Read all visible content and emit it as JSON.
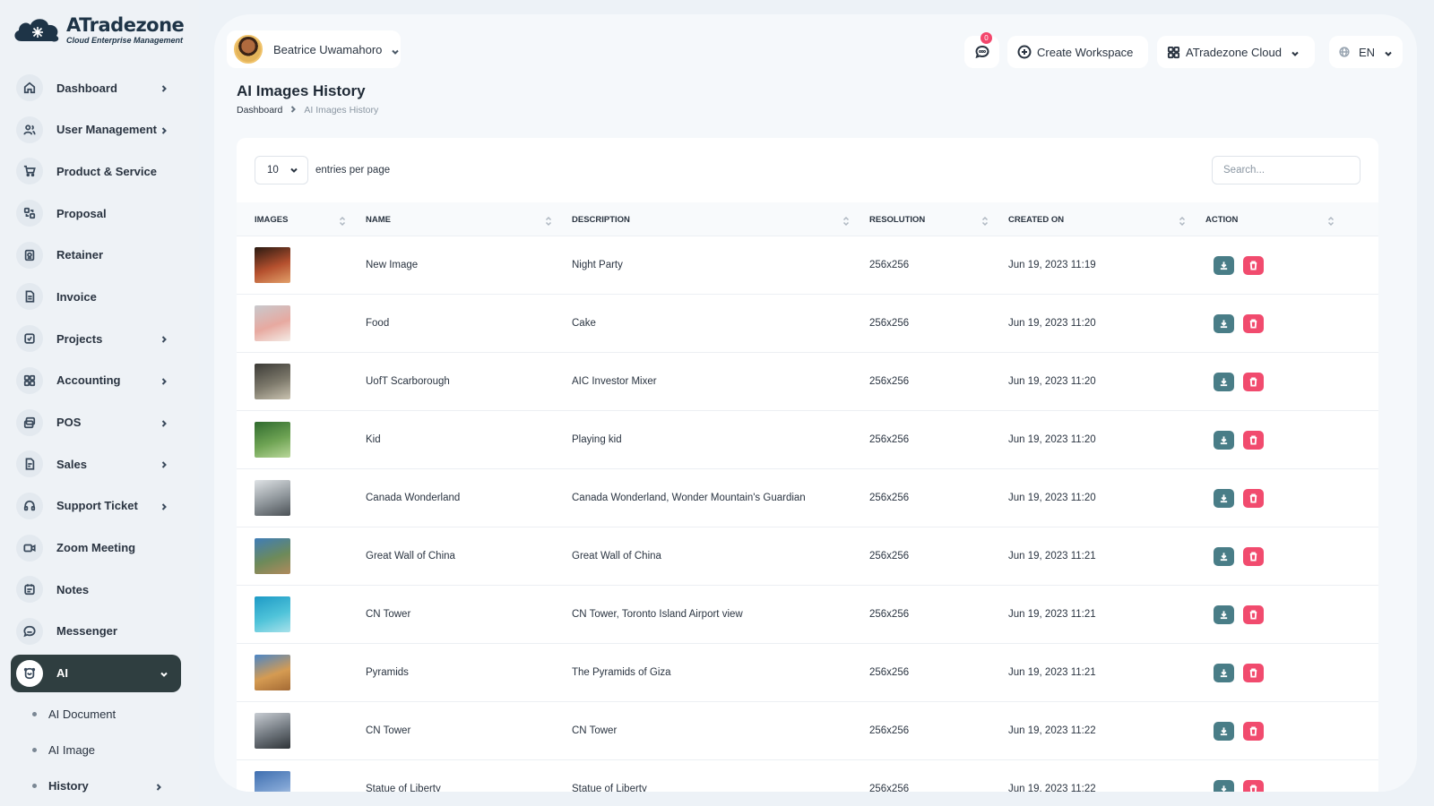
{
  "app": {
    "logo_name": "ATradezone",
    "logo_tagline": "Cloud Enterprise Management"
  },
  "sidebar": {
    "items": [
      {
        "label": "Dashboard",
        "icon": "home-icon",
        "chevron": true
      },
      {
        "label": "User Management",
        "icon": "users-icon",
        "chevron": true
      },
      {
        "label": "Product & Service",
        "icon": "cart-icon",
        "chevron": false
      },
      {
        "label": "Proposal",
        "icon": "proposal-icon",
        "chevron": false
      },
      {
        "label": "Retainer",
        "icon": "retainer-icon",
        "chevron": false
      },
      {
        "label": "Invoice",
        "icon": "invoice-icon",
        "chevron": false
      },
      {
        "label": "Projects",
        "icon": "projects-icon",
        "chevron": true
      },
      {
        "label": "Accounting",
        "icon": "accounting-icon",
        "chevron": true
      },
      {
        "label": "POS",
        "icon": "pos-icon",
        "chevron": true
      },
      {
        "label": "Sales",
        "icon": "sales-icon",
        "chevron": true
      },
      {
        "label": "Support Ticket",
        "icon": "headset-icon",
        "chevron": true
      },
      {
        "label": "Zoom Meeting",
        "icon": "video-icon",
        "chevron": false
      },
      {
        "label": "Notes",
        "icon": "notes-icon",
        "chevron": false
      },
      {
        "label": "Messenger",
        "icon": "chat-icon",
        "chevron": false
      },
      {
        "label": "AI",
        "icon": "ai-icon",
        "chevron": true,
        "active": true
      }
    ],
    "sub_items": [
      {
        "label": "AI Document"
      },
      {
        "label": "AI Image"
      },
      {
        "label": "History"
      }
    ]
  },
  "header": {
    "user_name": "Beatrice Uwamahoro",
    "notification_count": "0",
    "create_workspace": "Create Workspace",
    "workspace": "ATradezone Cloud",
    "language": "EN"
  },
  "page": {
    "title": "AI Images History",
    "breadcrumb_home": "Dashboard",
    "breadcrumb_current": "AI Images History"
  },
  "table": {
    "per_page": "10",
    "entries_label": "entries per page",
    "search_placeholder": "Search...",
    "columns": [
      "IMAGES",
      "NAME",
      "DESCRIPTION",
      "RESOLUTION",
      "CREATED ON",
      "ACTION"
    ],
    "rows": [
      {
        "name": "New Image",
        "description": "Night Party",
        "resolution": "256x256",
        "created": "Jun 19, 2023 11:19",
        "thumb": [
          "#2a1a12",
          "#b5502e",
          "#e2a06a"
        ]
      },
      {
        "name": "Food",
        "description": "Cake",
        "resolution": "256x256",
        "created": "Jun 19, 2023 11:20",
        "thumb": [
          "#c8c9cd",
          "#e7a9a0",
          "#f4ece6"
        ]
      },
      {
        "name": "UofT Scarborough",
        "description": "AIC Investor Mixer",
        "resolution": "256x256",
        "created": "Jun 19, 2023 11:20",
        "thumb": [
          "#3b3a36",
          "#7e7a6c",
          "#c9c2b0"
        ]
      },
      {
        "name": "Kid",
        "description": "Playing kid",
        "resolution": "256x256",
        "created": "Jun 19, 2023 11:20",
        "thumb": [
          "#2f6a2e",
          "#6fa454",
          "#b9d79a"
        ]
      },
      {
        "name": "Canada Wonderland",
        "description": "Canada Wonderland, Wonder Mountain's Guardian",
        "resolution": "256x256",
        "created": "Jun 19, 2023 11:20",
        "thumb": [
          "#dfe3e6",
          "#8e959a",
          "#4b5156"
        ]
      },
      {
        "name": "Great Wall of China",
        "description": "Great Wall of China",
        "resolution": "256x256",
        "created": "Jun 19, 2023 11:21",
        "thumb": [
          "#3f7db8",
          "#6d8a5a",
          "#b08a5c"
        ]
      },
      {
        "name": "CN Tower",
        "description": "CN Tower, Toronto Island Airport view",
        "resolution": "256x256",
        "created": "Jun 19, 2023 11:21",
        "thumb": [
          "#1e9ac6",
          "#4fc3d9",
          "#a7e1ea"
        ]
      },
      {
        "name": "Pyramids",
        "description": "The Pyramids of Giza",
        "resolution": "256x256",
        "created": "Jun 19, 2023 11:21",
        "thumb": [
          "#4b86c7",
          "#d59b52",
          "#a46a34"
        ]
      },
      {
        "name": "CN Tower",
        "description": "CN Tower",
        "resolution": "256x256",
        "created": "Jun 19, 2023 11:22",
        "thumb": [
          "#c8cdd3",
          "#6f767d",
          "#2f3438"
        ]
      },
      {
        "name": "Statue of Liberty",
        "description": "Statue of Liberty",
        "resolution": "256x256",
        "created": "Jun 19, 2023 11:22",
        "thumb": [
          "#3f6fb0",
          "#7fa3d3",
          "#d8e2ee"
        ]
      }
    ]
  },
  "colors": {
    "active_nav": "#2f3e40",
    "download_button": "#497d87",
    "delete_button": "#f14b6e",
    "badge": "#f3466c"
  }
}
